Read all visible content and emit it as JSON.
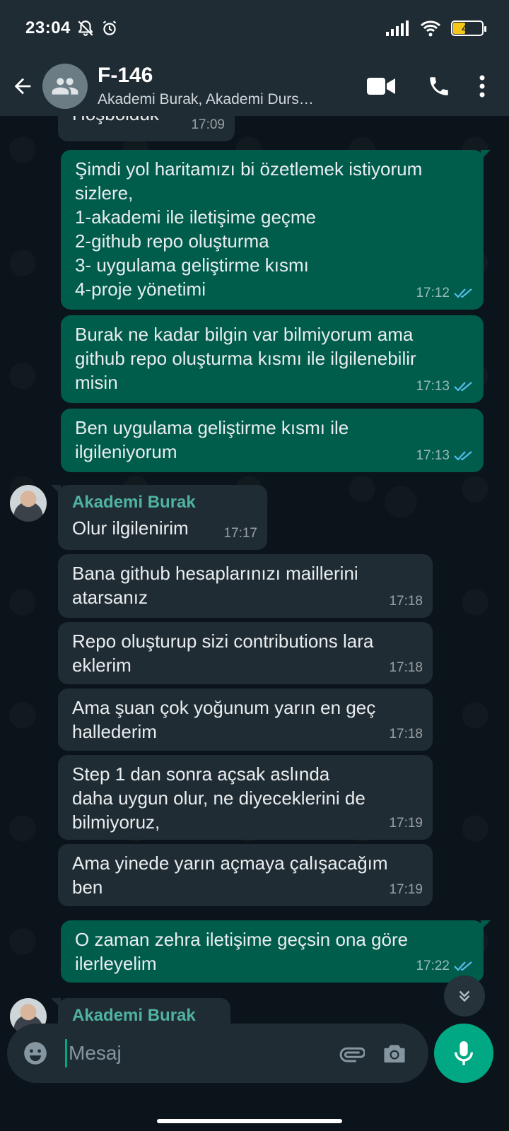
{
  "status_bar": {
    "time": "23:04",
    "battery": "40",
    "icons": [
      "dnd-bell-off-icon",
      "alarm-icon",
      "signal-icon",
      "wifi-icon",
      "battery-icon"
    ]
  },
  "header": {
    "title": "F-146",
    "subtitle": "Akademi Burak, Akademi Durs…",
    "icons": [
      "back-arrow-icon",
      "group-icon",
      "video-call-icon",
      "phone-call-icon",
      "more-vert-icon"
    ]
  },
  "messages": [
    {
      "dir": "in",
      "text": "Hoşboldük",
      "time": "17:09"
    },
    {
      "dir": "out",
      "text": "Şimdi yol haritamızı bi özetlemek istiyorum\nsizlere,\n1-akademi ile iletişime geçme\n2-github repo oluşturma\n3- uygulama geliştirme kısmı\n4-proje yönetimi",
      "time": "17:12",
      "status": "read"
    },
    {
      "dir": "out",
      "text": "Burak ne kadar bilgin var bilmiyorum ama\ngithub repo oluşturma kısmı ile ilgilenebilir\nmisin",
      "time": "17:13",
      "status": "read"
    },
    {
      "dir": "out",
      "text": "Ben uygulama geliştirme kısmı ile\nilgileniyorum",
      "time": "17:13",
      "status": "read"
    },
    {
      "dir": "in",
      "sender": "Akademi Burak",
      "text": "Olur ilgilenirim",
      "time": "17:17"
    },
    {
      "dir": "in",
      "text": "Bana github hesaplarınızı maillerini\natarsanız",
      "time": "17:18"
    },
    {
      "dir": "in",
      "text": "Repo oluşturup sizi contributions lara\neklerim",
      "time": "17:18"
    },
    {
      "dir": "in",
      "text": "Ama şuan çok yoğunum yarın en geç\nhallederim",
      "time": "17:18"
    },
    {
      "dir": "in",
      "text": "Step 1 dan sonra açsak aslında\ndaha uygun olur, ne diyeceklerini de\nbilmiyoruz,",
      "time": "17:19"
    },
    {
      "dir": "in",
      "text": "Ama yinede yarın açmaya çalışacağım\nben",
      "time": "17:19"
    },
    {
      "dir": "out",
      "text": "O zaman zehra iletişime geçsin ona göre\nilerleyelim",
      "time": "17:22",
      "status": "read"
    },
    {
      "dir": "in",
      "sender": "Akademi Burak",
      "text": "",
      "time": ""
    }
  ],
  "composer": {
    "placeholder": "Mesaj",
    "icons": [
      "emoji-icon",
      "attach-paperclip-icon",
      "camera-icon",
      "mic-icon"
    ]
  },
  "colors": {
    "background": "#0b141a",
    "header": "#1f2c34",
    "outgoing_bubble": "#005c4b",
    "incoming_bubble": "#202c33",
    "sender_name": "#4fb3a3",
    "accent": "#00a884",
    "read_ticks": "#53bdeb"
  }
}
